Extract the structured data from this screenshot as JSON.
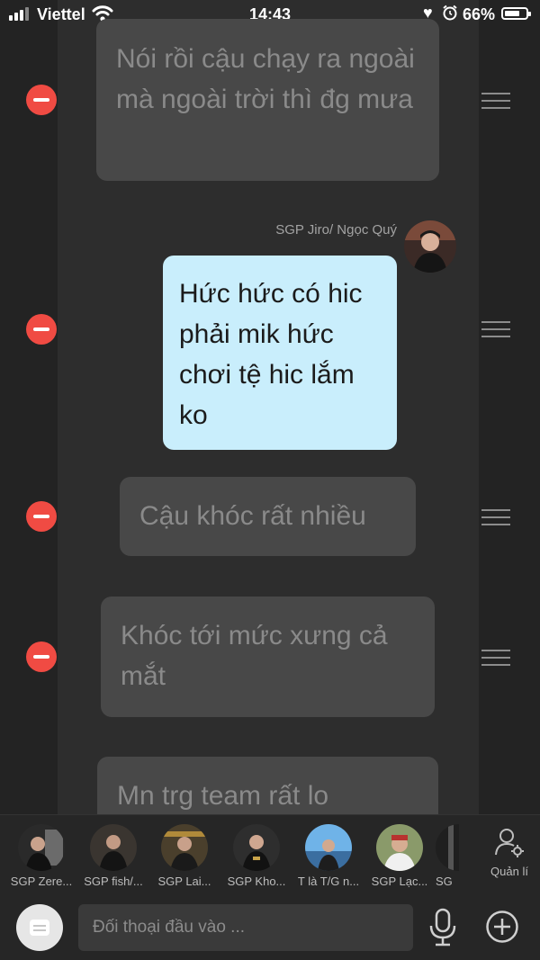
{
  "status_bar": {
    "carrier": "Viettel",
    "time": "14:43",
    "battery_percent": "66%"
  },
  "messages": [
    {
      "text": "Nói rồi cậu chạy ra ngoài mà ngoài trời thì đg mưa",
      "own": false
    },
    {
      "sender": "SGP Jiro/ Ngọc Quý",
      "text": "Hức hức có hic phải mik hức chơi tệ hic lắm ko",
      "own": true
    },
    {
      "text": "Cậu khóc rất nhiều",
      "own": false
    },
    {
      "text": "Khóc tới mức xưng cả mắt",
      "own": false
    },
    {
      "text": "Mn trg team rất lo",
      "own": false
    }
  ],
  "members": [
    {
      "name": "SGP Zere..."
    },
    {
      "name": "SGP fish/..."
    },
    {
      "name": "SGP Lai..."
    },
    {
      "name": "SGP Kho..."
    },
    {
      "name": "T là T/G n..."
    },
    {
      "name": "SGP Lạc..."
    },
    {
      "name": "SG"
    }
  ],
  "manage_label": "Quản lí",
  "composer": {
    "placeholder": "Đối thoại đầu vào ..."
  },
  "colors": {
    "own_bubble": "#c9eefc",
    "other_bubble": "#484848",
    "remove_button": "#f04b43",
    "background": "#232323"
  },
  "icons": [
    "signal-icon",
    "wifi-icon",
    "heart-icon",
    "alarm-icon",
    "battery-icon",
    "remove-icon",
    "drag-handle-icon",
    "manage-icon",
    "menu-icon",
    "microphone-icon",
    "plus-icon"
  ]
}
